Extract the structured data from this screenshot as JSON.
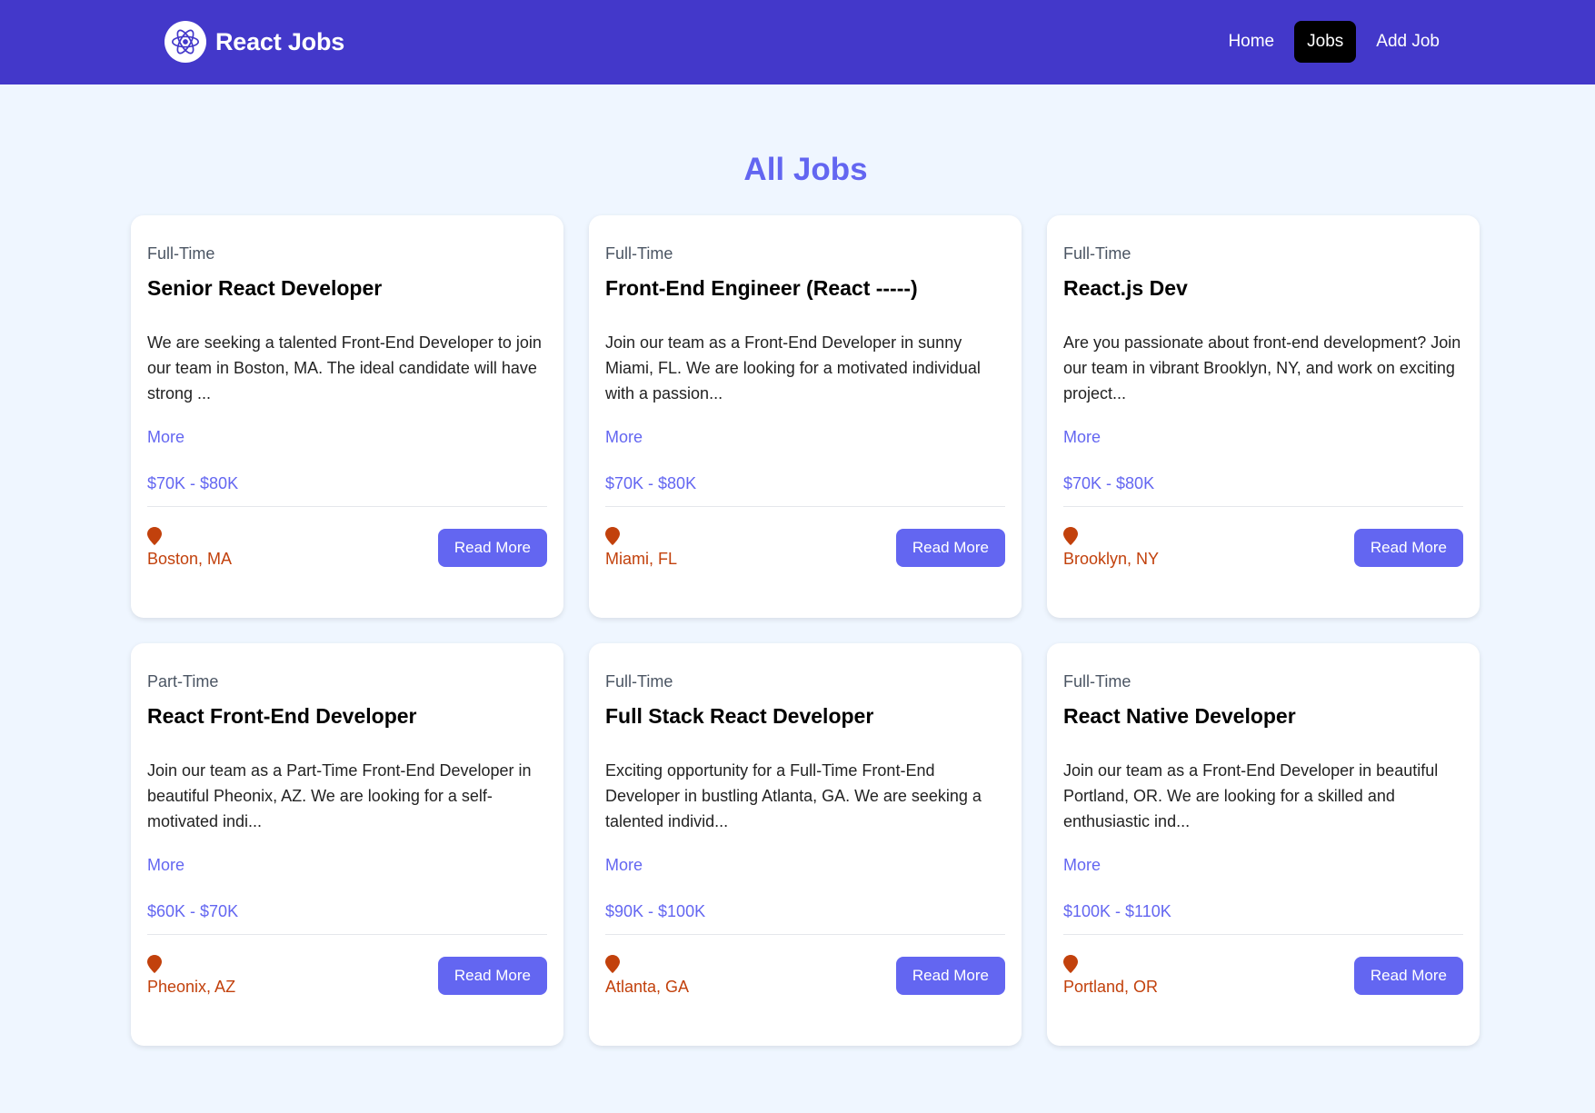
{
  "nav": {
    "brand": "React Jobs",
    "links": [
      {
        "label": "Home",
        "active": false
      },
      {
        "label": "Jobs",
        "active": true
      },
      {
        "label": "Add Job",
        "active": false
      }
    ]
  },
  "page": {
    "title": "All Jobs"
  },
  "colors": {
    "nav_bg": "#4338ca",
    "accent": "#6366f1",
    "location": "#c2410c",
    "page_bg": "#eff6ff"
  },
  "icons": {
    "logo": "react-atom-icon",
    "location": "map-marker-icon"
  },
  "jobs": [
    {
      "type": "Full-Time",
      "title": "Senior React Developer",
      "description": "We are seeking a talented Front-End Developer to join our team in Boston, MA. The ideal candidate will have strong ...",
      "more_label": "More",
      "salary": "$70K - $80K",
      "location": "Boston, MA",
      "button_label": "Read More"
    },
    {
      "type": "Full-Time",
      "title": "Front-End Engineer (React -----)",
      "description": "Join our team as a Front-End Developer in sunny Miami, FL. We are looking for a motivated individual with a passion...",
      "more_label": "More",
      "salary": "$70K - $80K",
      "location": "Miami, FL",
      "button_label": "Read More"
    },
    {
      "type": "Full-Time",
      "title": "React.js Dev",
      "description": "Are you passionate about front-end development? Join our team in vibrant Brooklyn, NY, and work on exciting project...",
      "more_label": "More",
      "salary": "$70K - $80K",
      "location": "Brooklyn, NY",
      "button_label": "Read More"
    },
    {
      "type": "Part-Time",
      "title": "React Front-End Developer",
      "description": "Join our team as a Part-Time Front-End Developer in beautiful Pheonix, AZ. We are looking for a self-motivated indi...",
      "more_label": "More",
      "salary": "$60K - $70K",
      "location": "Pheonix, AZ",
      "button_label": "Read More"
    },
    {
      "type": "Full-Time",
      "title": "Full Stack React Developer",
      "description": "Exciting opportunity for a Full-Time Front-End Developer in bustling Atlanta, GA. We are seeking a talented individ...",
      "more_label": "More",
      "salary": "$90K - $100K",
      "location": "Atlanta, GA",
      "button_label": "Read More"
    },
    {
      "type": "Full-Time",
      "title": "React Native Developer",
      "description": "Join our team as a Front-End Developer in beautiful Portland, OR. We are looking for a skilled and enthusiastic ind...",
      "more_label": "More",
      "salary": "$100K - $110K",
      "location": "Portland, OR",
      "button_label": "Read More"
    }
  ]
}
